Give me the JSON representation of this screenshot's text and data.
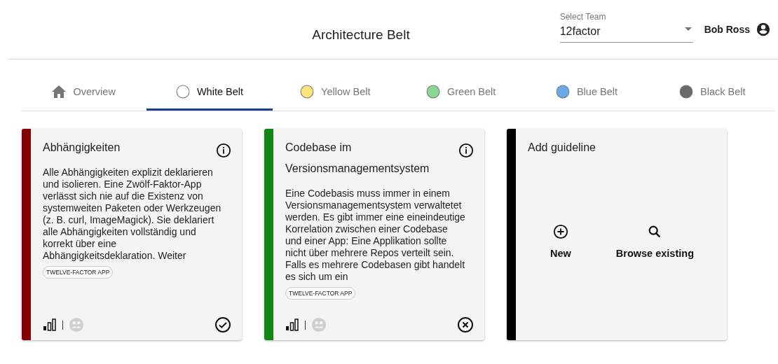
{
  "header": {
    "title": "Architecture Belt",
    "team_select": {
      "label": "Select Team",
      "value": "12factor"
    },
    "user": "Bob Ross"
  },
  "tabs": [
    {
      "label": "Overview",
      "kind": "home",
      "selected": false
    },
    {
      "label": "White Belt",
      "kind": "belt",
      "color": "#ffffff",
      "selected": true
    },
    {
      "label": "Yellow Belt",
      "kind": "belt",
      "color": "#fce47c",
      "selected": false
    },
    {
      "label": "Green Belt",
      "kind": "belt",
      "color": "#87d98f",
      "selected": false
    },
    {
      "label": "Blue Belt",
      "kind": "belt",
      "color": "#6aa9e8",
      "selected": false
    },
    {
      "label": "Black Belt",
      "kind": "belt",
      "color": "#6b6b6b",
      "selected": false
    }
  ],
  "cards": [
    {
      "kind": "guideline",
      "color": "#850000",
      "title": "Abhängigkeiten",
      "description": "Alle Abhängigkeiten explizit deklarieren und isolieren. Eine Zwölf-Faktor-App verlässt sich nie auf die Existenz von systemweiten Paketen oder Werkzeugen (z. B. curl, ImageMagick). Sie deklariert alle Abhängigkeiten vollständig und korrekt über eine Abhängigkeitsdeklaration. Weiter",
      "tag": "TWELVE-FACTOR APP",
      "done": true
    },
    {
      "kind": "guideline",
      "color": "#138613",
      "title": "Codebase im Versionsmanagementsystem",
      "description": "Eine Codebasis muss immer in einem Versionsmanagementsystem verwaltetet werden. Es gibt immer eine eineindeutige Korrelation zwischen einer Codebase und einer App: Eine Applikation sollte nicht über mehrere Repos verteilt sein. Falls es mehrere Codebasen gibt handelt es sich um ein",
      "tag": "TWELVE-FACTOR APP",
      "done": false
    },
    {
      "kind": "add",
      "color": "#000000",
      "title": "Add guideline",
      "actions": [
        {
          "label": "New",
          "kind": "new"
        },
        {
          "label": "Browse existing",
          "kind": "browse"
        }
      ]
    }
  ]
}
